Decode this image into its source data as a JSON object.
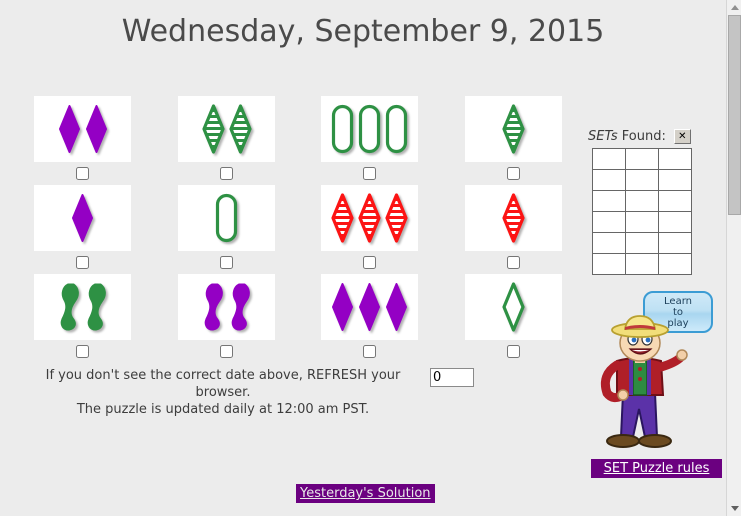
{
  "page": {
    "title": "Wednesday, September 9, 2015",
    "background_color": "#ececec"
  },
  "colors": {
    "purple": "#9400c4",
    "green": "#2e9144",
    "red": "#fc1414",
    "accent_purple": "#6b0080",
    "bubble_blue": "#3b9cd4"
  },
  "cards": [
    {
      "id": "card-1",
      "count": 2,
      "color": "purple",
      "shape": "diamond",
      "fill": "solid",
      "checkbox_checked": false
    },
    {
      "id": "card-2",
      "count": 2,
      "color": "green",
      "shape": "diamond",
      "fill": "striped",
      "checkbox_checked": false
    },
    {
      "id": "card-3",
      "count": 3,
      "color": "green",
      "shape": "oval",
      "fill": "open",
      "checkbox_checked": false
    },
    {
      "id": "card-4",
      "count": 1,
      "color": "green",
      "shape": "diamond",
      "fill": "striped",
      "checkbox_checked": false
    },
    {
      "id": "card-5",
      "count": 1,
      "color": "purple",
      "shape": "diamond",
      "fill": "solid",
      "checkbox_checked": false
    },
    {
      "id": "card-6",
      "count": 1,
      "color": "green",
      "shape": "oval",
      "fill": "open",
      "checkbox_checked": false
    },
    {
      "id": "card-7",
      "count": 3,
      "color": "red",
      "shape": "diamond",
      "fill": "striped",
      "checkbox_checked": false
    },
    {
      "id": "card-8",
      "count": 1,
      "color": "red",
      "shape": "diamond",
      "fill": "striped",
      "checkbox_checked": false
    },
    {
      "id": "card-9",
      "count": 2,
      "color": "green",
      "shape": "squiggle",
      "fill": "solid",
      "checkbox_checked": false
    },
    {
      "id": "card-10",
      "count": 2,
      "color": "purple",
      "shape": "squiggle",
      "fill": "solid",
      "checkbox_checked": false
    },
    {
      "id": "card-11",
      "count": 3,
      "color": "purple",
      "shape": "diamond",
      "fill": "solid",
      "checkbox_checked": false
    },
    {
      "id": "card-12",
      "count": 1,
      "color": "green",
      "shape": "diamond",
      "fill": "open",
      "checkbox_checked": false
    }
  ],
  "sets_found": {
    "label_italic": "SETs",
    "label_rest": " Found:",
    "close_label": "✕",
    "columns": 3,
    "rows": 6,
    "entries": []
  },
  "mascot": {
    "bubble_text": "Learn\nto\nplay",
    "bubble_line1": "Learn",
    "bubble_line2": "to",
    "bubble_line3": "play"
  },
  "rules_button": {
    "label": "SET Puzzle rules"
  },
  "notes": {
    "line1": "If you don't see the correct date above, REFRESH your browser.",
    "line2": "The puzzle is updated daily at 12:00 am PST."
  },
  "count_input": {
    "value": "0",
    "placeholder": ""
  },
  "yesterday_link": {
    "label": "Yesterday's Solution"
  },
  "scrollbar": {
    "up_label": "scroll-up",
    "down_label": "scroll-down"
  }
}
